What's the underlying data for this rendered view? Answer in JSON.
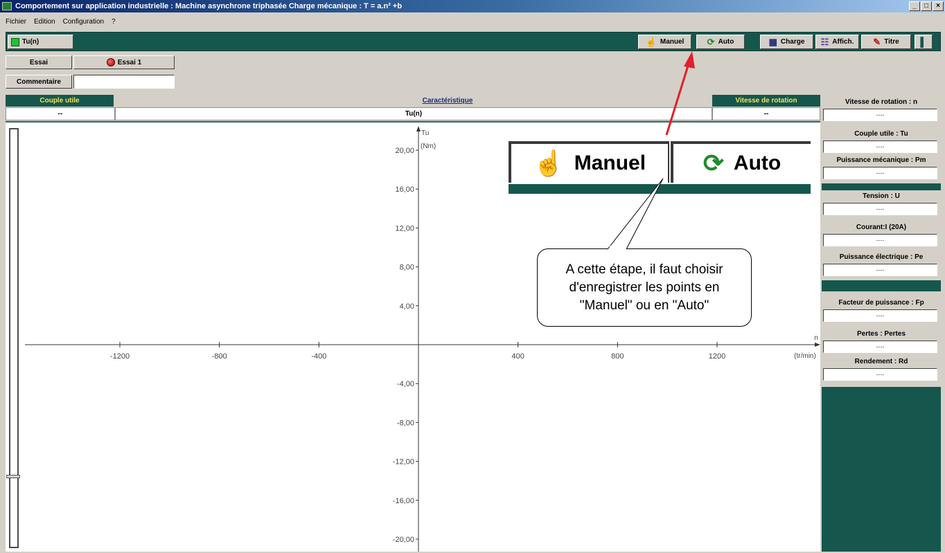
{
  "window": {
    "title": "Comportement sur application industrielle : Machine asynchrone triphasée Charge mécanique : T = a.n² +b",
    "controls": [
      "_",
      "□",
      "×"
    ]
  },
  "menu": [
    "Fichier",
    "Edition",
    "Configuration",
    "?"
  ],
  "toolbar": {
    "left_label": "Tu(n)",
    "manuel": "Manuel",
    "auto": "Auto",
    "charge": "Charge",
    "affich": "Affich.",
    "titre": "Titre"
  },
  "essai": {
    "label": "Essai",
    "button": "Essai 1"
  },
  "commentaire": {
    "label": "Commentaire",
    "value": ""
  },
  "headers": {
    "couple_utile": "Couple utile",
    "caracteristique": "Caractéristique",
    "vitesse_rotation": "Vitesse de rotation",
    "couple_value": "--",
    "carac_value": "Tu(n)",
    "vitesse_value": "--"
  },
  "measures": [
    {
      "label": "Vitesse de rotation : n",
      "value": "----"
    },
    {
      "label": "Couple utile : Tu",
      "value": "----"
    },
    {
      "label": "Puissance mécanique : Pm",
      "value": "----"
    },
    {
      "label": "Tension : U",
      "value": "----"
    },
    {
      "label": "Courant:I (20A)",
      "value": "----"
    },
    {
      "label": "Puissance électrique : Pe",
      "value": "----"
    },
    {
      "label": "Facteur de puissance : Fp",
      "value": "----"
    },
    {
      "label": "Pertes : Pertes",
      "value": "----"
    },
    {
      "label": "Rendement : Rd",
      "value": "----"
    }
  ],
  "chart_data": {
    "type": "line",
    "ylabel": "Tu",
    "yunit": "(Nm)",
    "xlabel": "n",
    "xunit": "(tr/min)",
    "x_ticks": [
      "-1200",
      "-800",
      "-400",
      "400",
      "800",
      "1200"
    ],
    "y_ticks": [
      "20,00",
      "16,00",
      "12,00",
      "8,00",
      "4,00",
      "-4,00",
      "-8,00",
      "-12,00",
      "-16,00",
      "-20,00"
    ],
    "x_tick_values": [
      -1200,
      -800,
      -400,
      400,
      800,
      1200
    ],
    "y_tick_values": [
      20,
      16,
      12,
      8,
      4,
      -4,
      -8,
      -12,
      -16,
      -20
    ],
    "xlim": [
      -1650,
      1650
    ],
    "ylim": [
      -21,
      21
    ],
    "series": []
  },
  "zoom": {
    "manuel": "Manuel",
    "auto": "Auto"
  },
  "callout": {
    "line1": "A cette étape, il faut choisir",
    "line2": "d'enregistrer les points en",
    "line3": "\"Manuel\" ou en \"Auto\""
  },
  "colors": {
    "accent": "#15574d",
    "arrow": "#e0202a",
    "header_text": "#f2e55a"
  }
}
